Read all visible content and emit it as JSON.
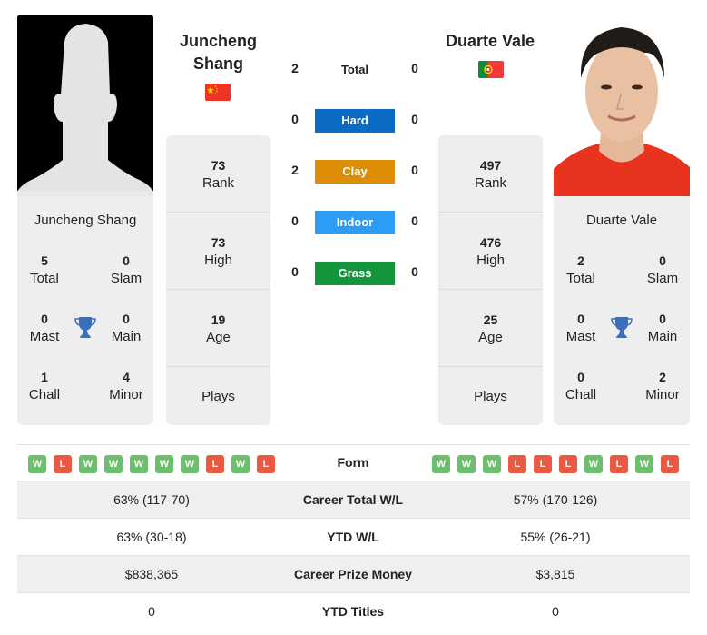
{
  "player_left": {
    "name_line1": "Juncheng",
    "name_line2": "Shang",
    "full_name": "Juncheng Shang",
    "flag": "china-flag",
    "photo": "silhouette-placeholder",
    "titles": {
      "total": {
        "value": "5",
        "label": "Total"
      },
      "slam": {
        "value": "0",
        "label": "Slam"
      },
      "mast": {
        "value": "0",
        "label": "Mast"
      },
      "main": {
        "value": "0",
        "label": "Main"
      },
      "chall": {
        "value": "1",
        "label": "Chall"
      },
      "minor": {
        "value": "4",
        "label": "Minor"
      }
    },
    "info": {
      "rank": {
        "value": "73",
        "label": "Rank"
      },
      "high": {
        "value": "73",
        "label": "High"
      },
      "age": {
        "value": "19",
        "label": "Age"
      },
      "plays": {
        "value": "",
        "label": "Plays"
      }
    },
    "form": [
      "W",
      "L",
      "W",
      "W",
      "W",
      "W",
      "W",
      "L",
      "W",
      "L"
    ]
  },
  "player_right": {
    "name": "Duarte Vale",
    "full_name": "Duarte Vale",
    "flag": "portugal-flag",
    "photo": "player-headshot",
    "titles": {
      "total": {
        "value": "2",
        "label": "Total"
      },
      "slam": {
        "value": "0",
        "label": "Slam"
      },
      "mast": {
        "value": "0",
        "label": "Mast"
      },
      "main": {
        "value": "0",
        "label": "Main"
      },
      "chall": {
        "value": "0",
        "label": "Chall"
      },
      "minor": {
        "value": "2",
        "label": "Minor"
      }
    },
    "info": {
      "rank": {
        "value": "497",
        "label": "Rank"
      },
      "high": {
        "value": "476",
        "label": "High"
      },
      "age": {
        "value": "25",
        "label": "Age"
      },
      "plays": {
        "value": "",
        "label": "Plays"
      }
    },
    "form": [
      "W",
      "W",
      "W",
      "L",
      "L",
      "L",
      "W",
      "L",
      "W",
      "L"
    ]
  },
  "h2h": {
    "total": {
      "label": "Total",
      "left": "2",
      "right": "0"
    },
    "surfaces": [
      {
        "label": "Hard",
        "left": "0",
        "right": "0",
        "color": "#0a6cc2"
      },
      {
        "label": "Clay",
        "left": "2",
        "right": "0",
        "color": "#dd8d06"
      },
      {
        "label": "Indoor",
        "left": "0",
        "right": "0",
        "color": "#2c9cf4"
      },
      {
        "label": "Grass",
        "left": "0",
        "right": "0",
        "color": "#13963b"
      }
    ]
  },
  "form_label": "Form",
  "stats": [
    {
      "label": "Career Total W/L",
      "left": "63% (117-70)",
      "right": "57% (170-126)"
    },
    {
      "label": "YTD W/L",
      "left": "63% (30-18)",
      "right": "55% (26-21)"
    },
    {
      "label": "Career Prize Money",
      "left": "$838,365",
      "right": "$3,815"
    },
    {
      "label": "YTD Titles",
      "left": "0",
      "right": "0"
    }
  ],
  "colors": {
    "win": "#6cbf6c",
    "loss": "#ea5a43",
    "trophy": "#3a6fbf",
    "card_bg": "#eeeeee"
  }
}
